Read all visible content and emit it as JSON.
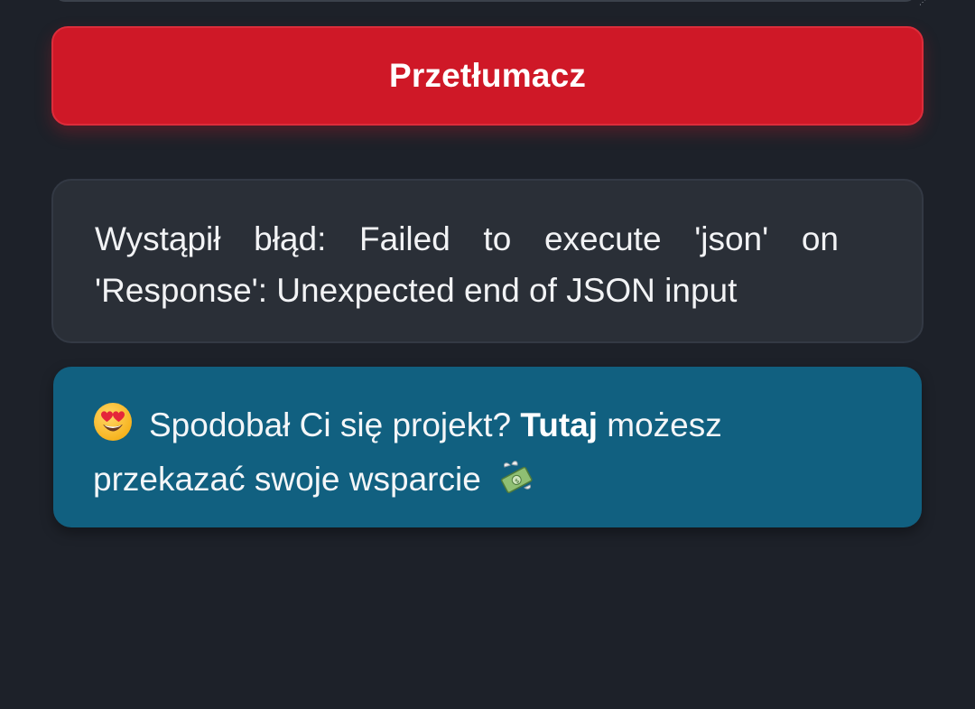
{
  "translate_button": {
    "label": "Przetłumacz"
  },
  "error": {
    "message": "Wystąpił błąd: Failed to execute 'json' on 'Response': Unexpected end of JSON input"
  },
  "support": {
    "text_before": "Spodobał Ci się projekt?",
    "link_label": "Tutaj",
    "text_after": "możesz przekazać swoje wsparcie",
    "emoji_start": "heart-eyes-emoji",
    "emoji_end": "money-with-wings-emoji"
  },
  "colors": {
    "background": "#1d2129",
    "button": "#cf1827",
    "error_box": "#2a2f37",
    "support_box": "#116080"
  }
}
